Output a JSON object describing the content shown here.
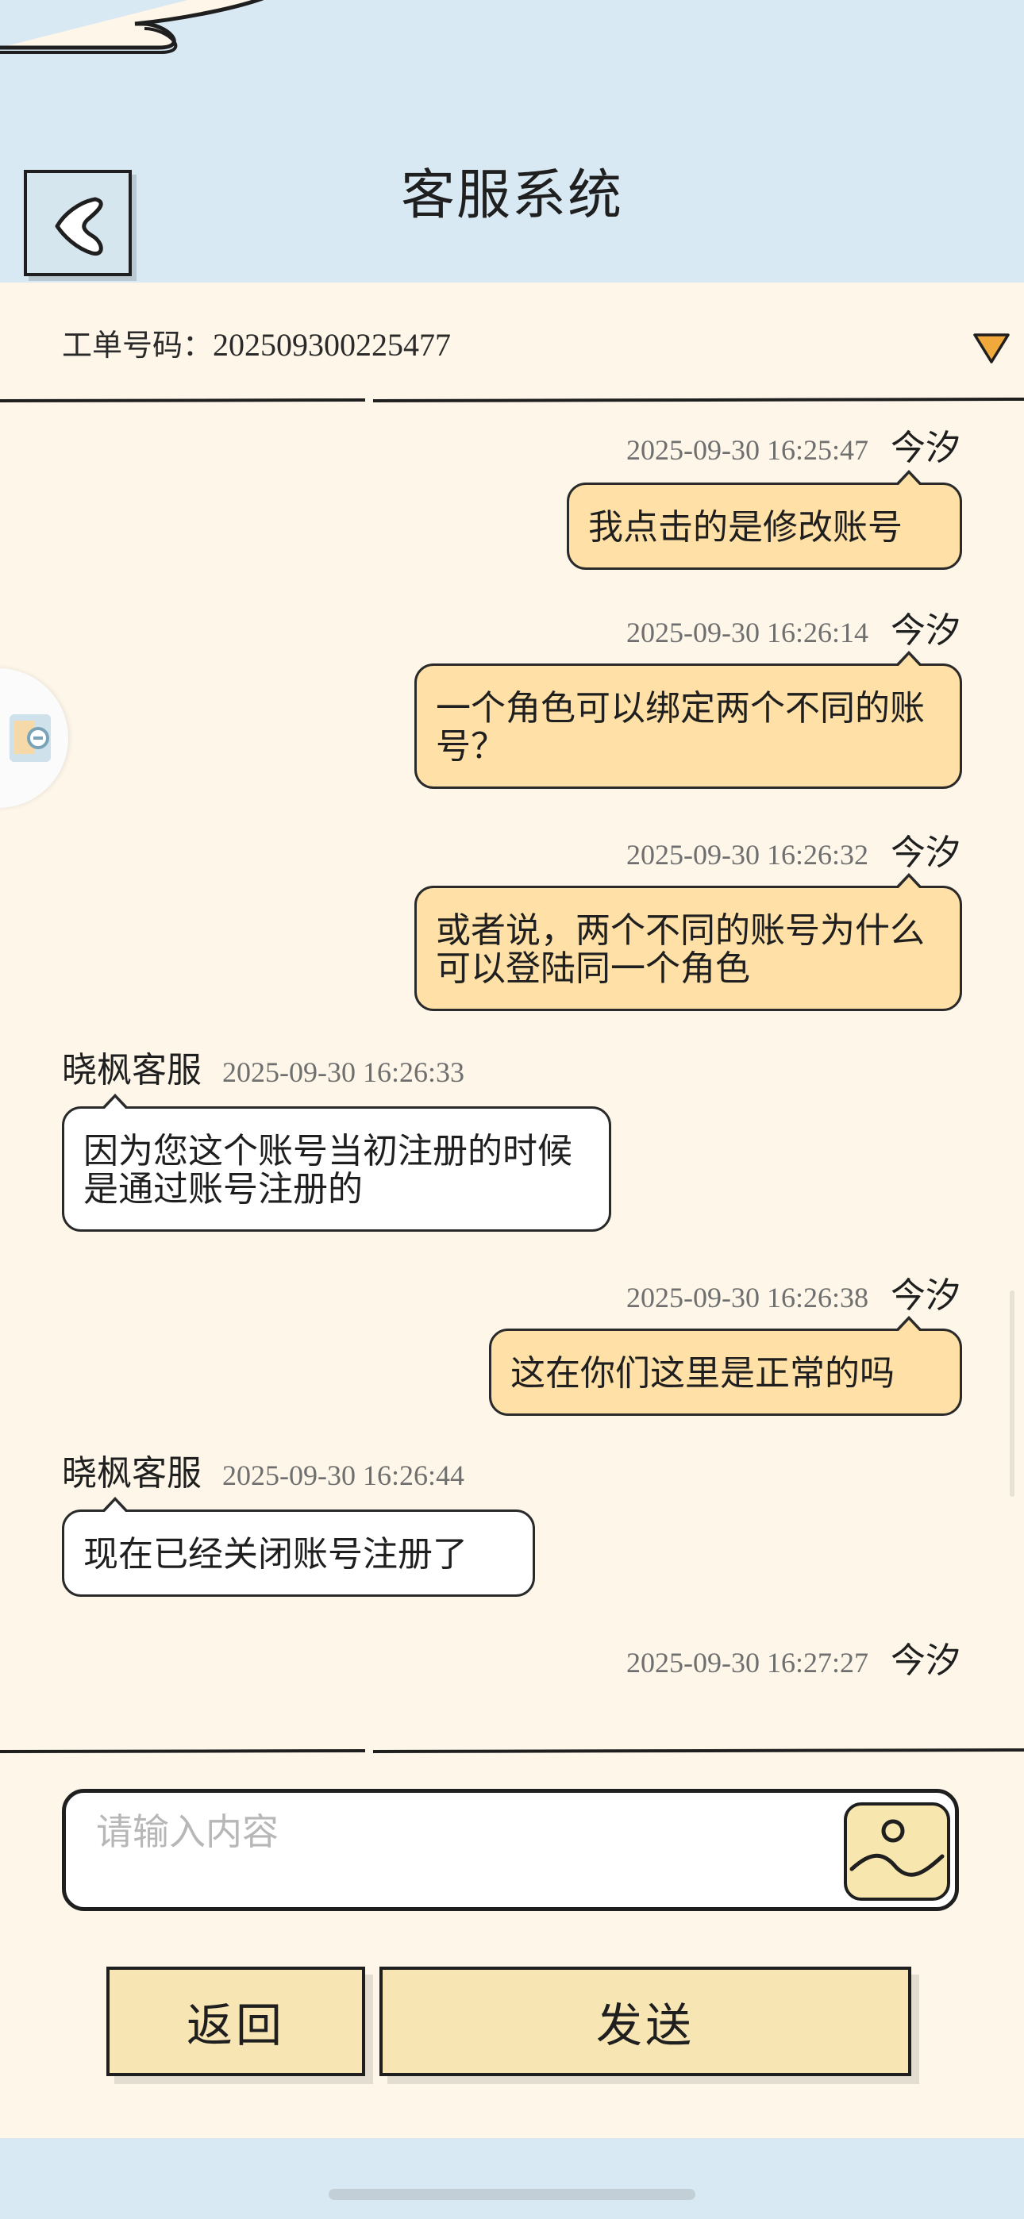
{
  "header": {
    "title": "客服系统"
  },
  "ticket": {
    "label": "工单号码：",
    "number": "202509300225477"
  },
  "messages": [
    {
      "sender": "今汐",
      "time": "2025-09-30 16:25:47",
      "text": "我点击的是修改账号"
    },
    {
      "sender": "今汐",
      "time": "2025-09-30 16:26:14",
      "text": "一个角色可以绑定两个不同的账号？"
    },
    {
      "sender": "今汐",
      "time": "2025-09-30 16:26:32",
      "text": "或者说，两个不同的账号为什么可以登陆同一个角色"
    },
    {
      "sender": "晓枫客服",
      "time": "2025-09-30 16:26:33",
      "text": "因为您这个账号当初注册的时候是通过账号注册的"
    },
    {
      "sender": "今汐",
      "time": "2025-09-30 16:26:38",
      "text": "这在你们这里是正常的吗"
    },
    {
      "sender": "晓枫客服",
      "time": "2025-09-30 16:26:44",
      "text": "现在已经关闭账号注册了"
    },
    {
      "sender": "今汐",
      "time": "2025-09-30 16:27:27",
      "text": ""
    }
  ],
  "input": {
    "placeholder": "请输入内容",
    "image_icon": "image-icon"
  },
  "buttons": {
    "return_label": "返回",
    "send_label": "发送"
  },
  "icons": {
    "back": "back-chevron-icon",
    "dropdown": "dropdown-triangle-icon",
    "side_float": "floating-assistant-icon"
  },
  "colors": {
    "header_bg": "#d8e9f3",
    "page_bg": "#fdf6e9",
    "user_bubble": "#ffe0a6",
    "agent_bubble": "#ffffff",
    "button_bg": "#f7e6b4",
    "dropdown": "#f2a93b"
  }
}
